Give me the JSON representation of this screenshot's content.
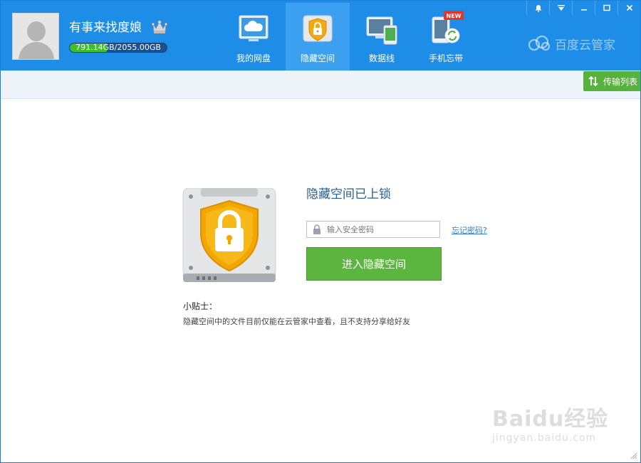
{
  "user": {
    "name": "有事来找度娘",
    "quota_used": "791.14",
    "quota_total": "GB/2055.00GB",
    "quota_fraction": 0.385
  },
  "nav": {
    "items": [
      {
        "label": "我的网盘",
        "icon": "cloud-drive-icon"
      },
      {
        "label": "隐藏空间",
        "icon": "shield-lock-icon",
        "active": true
      },
      {
        "label": "数据线",
        "icon": "devices-icon"
      },
      {
        "label": "手机忘带",
        "icon": "phone-sync-icon",
        "badge": "NEW"
      }
    ]
  },
  "brand": {
    "name": "百度云管家"
  },
  "toolbar": {
    "transfer_label": "传输列表"
  },
  "main": {
    "title": "隐藏空间已上锁",
    "password_placeholder": "输入安全密码",
    "forgot_label": "忘记密码?",
    "enter_label": "进入隐藏空间",
    "tips_title": "小贴士：",
    "tips_text": "隐藏空间中的文件目前仅能在云管家中查看，且不支持分享给好友"
  },
  "watermark": {
    "main": "Baidu经验",
    "sub": "jingyan.baidu.com"
  },
  "colors": {
    "header_bg": "#1e8de8",
    "active_tab": "#3ba0f0",
    "accent_green": "#5cb53e",
    "title_blue": "#2a5d8c",
    "link_blue": "#2f7fd1"
  }
}
